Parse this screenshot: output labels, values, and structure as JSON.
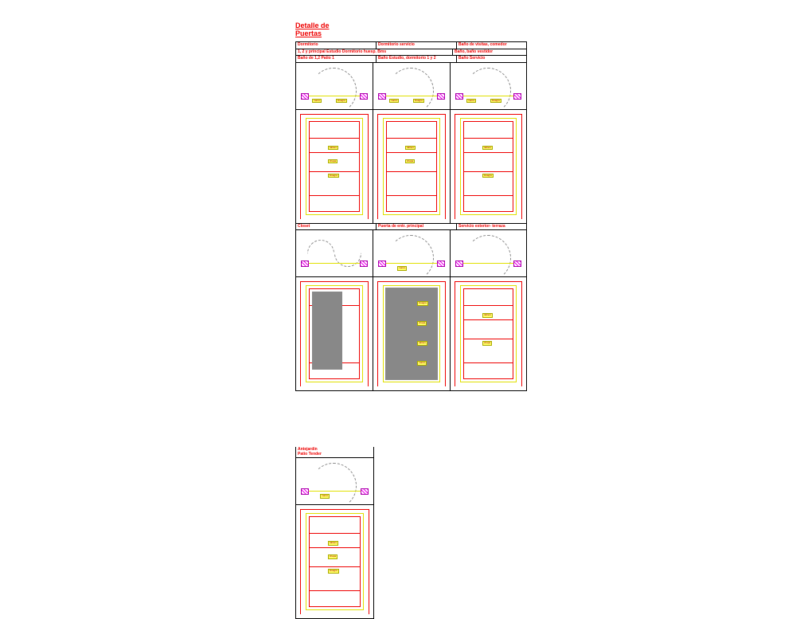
{
  "title_line1": "Detalle de",
  "title_line2": "Puertas",
  "headers": {
    "r1": [
      "Dormitorio",
      "Dormitorio servicio",
      "Baño de visitas, comedor"
    ],
    "r2": [
      "1, 2 y principal  Estudio  Dormitorio huesp.  Bms",
      "",
      "Baño, baño vestidor"
    ],
    "r3": [
      "Baño de 1,2   Patio 1",
      "Baño   Estudio, dormitorio 1 y 2",
      "Baño  Servicio"
    ]
  },
  "row2_titles": [
    "Closet",
    "Puerta de entr. principal",
    "Servicio exterior- terraza"
  ],
  "section2": {
    "t1": "Antejardín",
    "t2": "Patio Tender"
  },
  "labels": {
    "marco": "marco",
    "bisagra": "bisagra",
    "tablero": "tablero",
    "chapa": "chapa"
  }
}
